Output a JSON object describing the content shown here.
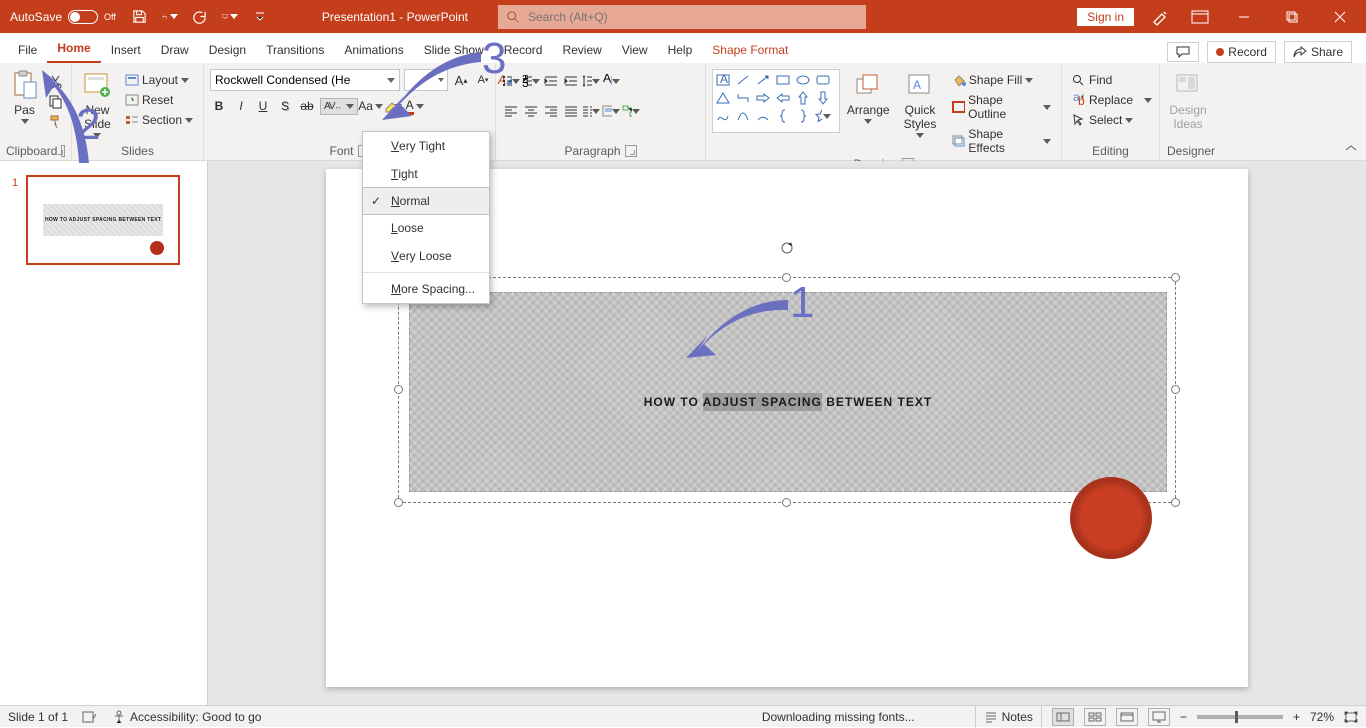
{
  "title_bar": {
    "autosave_label": "AutoSave",
    "autosave_state": "Off",
    "doc_title": "Presentation1 - PowerPoint",
    "search_placeholder": "Search (Alt+Q)",
    "signin": "Sign in"
  },
  "tabs": {
    "file": "File",
    "home": "Home",
    "insert": "Insert",
    "draw": "Draw",
    "design": "Design",
    "transitions": "Transitions",
    "animations": "Animations",
    "slideshow": "Slide Show",
    "record": "Record",
    "review": "Review",
    "view": "View",
    "help": "Help",
    "shape_format": "Shape Format",
    "record_btn": "Record",
    "share_btn": "Share"
  },
  "ribbon": {
    "clipboard": {
      "paste": "Pas",
      "paste_full": "Paste",
      "label": "Clipboard"
    },
    "slides": {
      "new_slide": "New\nSlide",
      "layout": "Layout",
      "reset": "Reset",
      "section": "Section",
      "label": "Slides"
    },
    "font": {
      "font_name": "Rockwell Condensed (He",
      "size": "",
      "label": "Font"
    },
    "paragraph": {
      "label": "Paragraph"
    },
    "drawing": {
      "arrange": "Arrange",
      "quick_styles": "Quick\nStyles",
      "shape_fill": "Shape Fill",
      "shape_outline": "Shape Outline",
      "shape_effects": "Shape Effects",
      "label": "Drawing"
    },
    "editing": {
      "find": "Find",
      "replace": "Replace",
      "select": "Select",
      "label": "Editing"
    },
    "designer": {
      "design_ideas": "Design\nIdeas",
      "label": "Designer"
    }
  },
  "spacing_menu": {
    "very_tight": "ery Tight",
    "very_tight_u": "V",
    "tight": "ight",
    "tight_u": "T",
    "normal": "ormal",
    "normal_u": "N",
    "loose": "oose",
    "loose_u": "L",
    "very_loose": "ery Loose",
    "very_loose_u": "V",
    "more": "ore Spacing...",
    "more_u": "M"
  },
  "thumbs": {
    "num1": "1",
    "thumb_text": "HOW TO ADJUST SPACING BETWEEN TEXT"
  },
  "slide": {
    "text_pre": "HOW TO ",
    "text_sel": "ADJUST SPACING",
    "text_post": " BETWEEN TEXT"
  },
  "annotations": {
    "n1": "1",
    "n2": "2",
    "n3": "3"
  },
  "status": {
    "slide_of": "Slide 1 of 1",
    "accessibility": "Accessibility: Good to go",
    "download": "Downloading missing fonts...",
    "notes": "Notes",
    "zoom": "72%"
  }
}
